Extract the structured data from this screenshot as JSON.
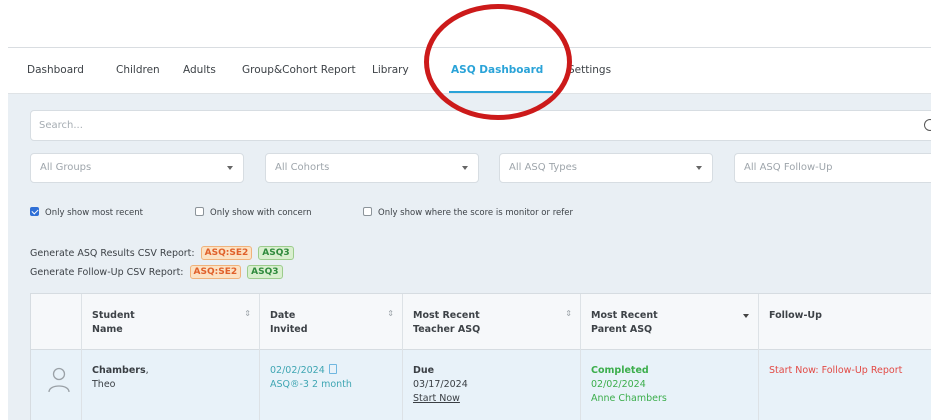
{
  "nav": {
    "items": [
      {
        "label": "Dashboard"
      },
      {
        "label": "Children"
      },
      {
        "label": "Adults"
      },
      {
        "label": "Group&Cohort Report"
      },
      {
        "label": "Library"
      },
      {
        "label": "ASQ Dashboard",
        "active": true
      },
      {
        "label": "Settings"
      }
    ]
  },
  "search": {
    "placeholder": "Search..."
  },
  "filters": {
    "groups": "All Groups",
    "cohorts": "All Cohorts",
    "asq_types": "All ASQ Types",
    "asq_follow_up": "All ASQ Follow-Up"
  },
  "checkboxes": [
    {
      "label": "Only show most recent",
      "checked": true
    },
    {
      "label": "Only show with concern",
      "checked": false
    },
    {
      "label": "Only show where the score is monitor or refer",
      "checked": false
    }
  ],
  "reports": {
    "results_label": "Generate ASQ Results CSV Report:",
    "followup_label": "Generate Follow-Up CSV Report:",
    "badge_se2": "ASQ:SE2",
    "badge_asq3": "ASQ3"
  },
  "table": {
    "headers": {
      "student_l1": "Student",
      "student_l2": "Name",
      "date_l1": "Date",
      "date_l2": "Invited",
      "teacher_l1": "Most Recent",
      "teacher_l2": "Teacher ASQ",
      "parent_l1": "Most Recent",
      "parent_l2": "Parent ASQ",
      "followup": "Follow-Up"
    },
    "row": {
      "last_name": "Chambers",
      "first_name": "Theo",
      "date_invited": "02/02/2024",
      "asq_type": "ASQ®-3 2 month",
      "teacher_status": "Due",
      "teacher_date": "03/17/2024",
      "teacher_action": "Start Now",
      "parent_status": "Completed",
      "parent_date": "02/02/2024",
      "parent_by": "Anne Chambers",
      "followup_action": "Start Now: Follow-Up Report"
    }
  },
  "colors": {
    "accent": "#2aa3d8",
    "annotation": "#cc1a1a",
    "completed": "#3cae4c",
    "followup": "#e24a45"
  }
}
